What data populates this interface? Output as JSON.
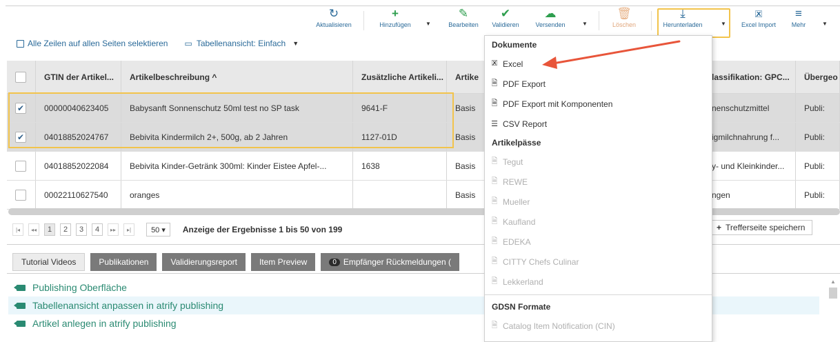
{
  "toolbar": {
    "refresh": "Aktualisieren",
    "add": "Hinzufügen",
    "edit": "Bearbeiten",
    "validate": "Validieren",
    "send": "Versenden",
    "delete": "Löschen",
    "download": "Herunterladen",
    "excel_import": "Excel Import",
    "more": "Mehr"
  },
  "selection": {
    "select_all": "Alle Zeilen auf allen Seiten selektieren",
    "table_view": "Tabellenansicht: Einfach"
  },
  "grid": {
    "columns": [
      "GTIN der Artikel...",
      "Artikelbeschreibung ^",
      "Zusätzliche Artikeli...",
      "Artike",
      "lassifikation: GPC...",
      "Übergeo"
    ],
    "rows": [
      {
        "checked": true,
        "gtin": "00000040623405",
        "desc": "Babysanft Sonnenschutz 50ml test no SP task",
        "extra": "9641-F",
        "type": "Basis",
        "gpc": "nenschutzmittel",
        "status": "Publi:"
      },
      {
        "checked": true,
        "gtin": "04018852024767",
        "desc": "Bebivita Kindermilch 2+, 500g, ab 2 Jahren",
        "extra": "1127-01D",
        "type": "Basis",
        "gpc": "igmilchnahrung f...",
        "status": "Publi:"
      },
      {
        "checked": false,
        "gtin": "04018852022084",
        "desc": "Bebivita Kinder-Getränk 300ml: Kinder Eistee Apfel-...",
        "extra": "1638",
        "type": "Basis",
        "gpc": "y- und Kleinkinder...",
        "status": "Publi:"
      },
      {
        "checked": false,
        "gtin": "00022110627540",
        "desc": "oranges",
        "extra": "",
        "type": "Basis",
        "gpc": "ngen",
        "status": "Publi:"
      }
    ]
  },
  "pager": {
    "first": "|◂",
    "prev": "◂◂",
    "pages": [
      "1",
      "2",
      "3",
      "4"
    ],
    "next": "▸▸",
    "last": "▸|",
    "per_page": "50 ▾",
    "summary": "Anzeige der Ergebnisse 1 bis 50 von 199",
    "save": "Trefferseite speichern"
  },
  "tabs": {
    "tutorial": "Tutorial Videos",
    "publications": "Publikationen",
    "validation": "Validierungsreport",
    "preview": "Item Preview",
    "feedback_count": "0",
    "feedback": "Empfänger Rückmeldungen ("
  },
  "videos": [
    "Publishing Oberfläche",
    "Tabellenansicht anpassen in atrify publishing",
    "Artikel anlegen in atrify publishing"
  ],
  "dropdown": {
    "sec_docs": "Dokumente",
    "excel": "Excel",
    "pdf": "PDF Export",
    "pdf_comp": "PDF Export mit Komponenten",
    "csv": "CSV Report",
    "sec_pass": "Artikelpässe",
    "tegut": "Tegut",
    "rewe": "REWE",
    "mueller": "Mueller",
    "kaufland": "Kaufland",
    "edeka": "EDEKA",
    "citty": "CITTY Chefs Culinar",
    "lekkerland": "Lekkerland",
    "sec_gdsn": "GDSN Formate",
    "cin": "Catalog Item Notification (CIN)"
  },
  "colors": {
    "accent_blue": "#2a6a99",
    "highlight": "#f2c34b",
    "arrow": "#e8553a",
    "green": "#2e9e4e"
  }
}
